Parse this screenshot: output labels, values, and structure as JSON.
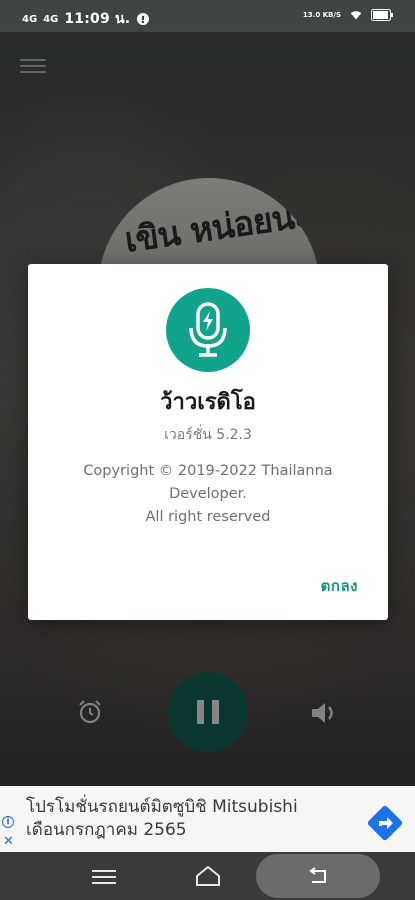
{
  "status_bar": {
    "signal1": "4G",
    "signal2": "4G",
    "time": "11:09 น.",
    "network_speed": "13.0 KB/S",
    "battery": "battery-icon"
  },
  "album": {
    "title_art": "เขิน หน่อยนะ"
  },
  "dialog": {
    "app_name": "ว้าวเรดิโอ",
    "version": "เวอร์ชั่น 5.2.3",
    "copyright_line1": "Copyright © 2019-2022 Thailanna",
    "copyright_line2": "Developer.",
    "copyright_line3": "All right reserved",
    "ok_label": "ตกลง"
  },
  "ad": {
    "line1": "โปรโมชั่นรถยนต์มิตซูบิชิ Mitsubishi",
    "line2": "เดือนกรกฎาคม 2565",
    "info_icon": "info-icon",
    "close_icon": "close-icon"
  },
  "colors": {
    "accent": "#12a38c",
    "ok_text": "#1e8f7a",
    "play_button": "#0f5a4c"
  }
}
